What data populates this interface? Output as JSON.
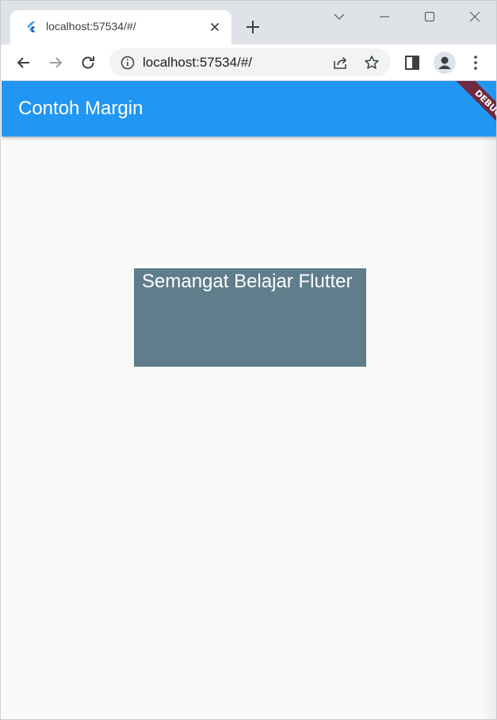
{
  "browser": {
    "tab": {
      "title": "localhost:57534/#/",
      "favicon": "flutter-logo-icon"
    },
    "address_bar": {
      "url": "localhost:57534/#/"
    },
    "icons": {
      "back": "arrow-left-icon",
      "forward": "arrow-right-icon",
      "reload": "reload-icon",
      "info": "info-icon",
      "share": "share-icon",
      "star": "star-icon",
      "side_panel": "side-panel-icon",
      "profile": "person-icon",
      "menu": "kebab-menu-icon"
    }
  },
  "app": {
    "title": "Contoh Margin",
    "debug_banner": "DEBUG",
    "box_text": "Semangat Belajar Flutter"
  },
  "colors": {
    "appbar": "#2196f3",
    "box": "#607d8b",
    "background": "#fafafa",
    "debug": "#6f2a3f"
  }
}
